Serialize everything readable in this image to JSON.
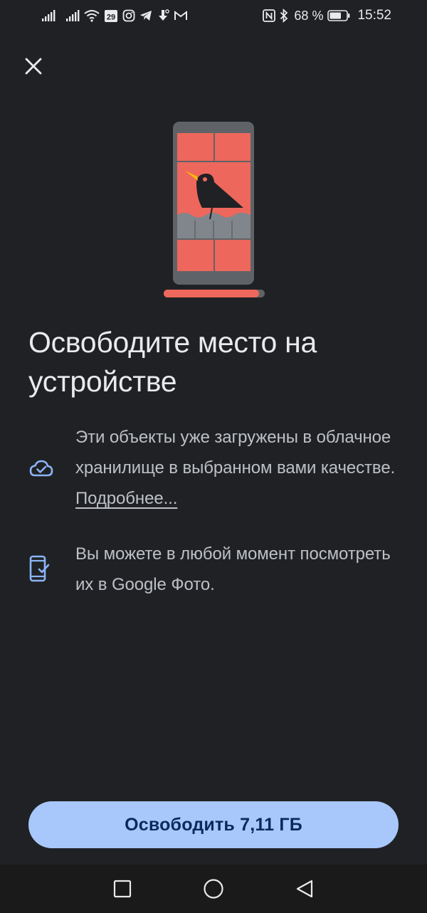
{
  "status_bar": {
    "battery_percent": "68 %",
    "time": "15:52",
    "calendar_badge": "29",
    "icons": [
      "signal-icon",
      "signal-icon",
      "wifi-icon",
      "calendar-icon",
      "instagram-icon",
      "telegram-icon",
      "download-icon",
      "gmail-icon",
      "nfc-icon",
      "bluetooth-icon",
      "battery-icon"
    ]
  },
  "header": {
    "close_icon": "close-icon"
  },
  "illustration": {
    "icon": "phone-bird-illustration",
    "colors": {
      "tile": "#ee675c",
      "frame": "#5f6368",
      "bird": "#202124",
      "beak": "#fbbc04",
      "fence": "#80868b"
    }
  },
  "title": "Освободите место на устройстве",
  "info_items": [
    {
      "icon": "cloud-done-icon",
      "text": "Эти объекты уже загружены в облачное хранилище в выбранном вами качестве.",
      "link": "Подробнее..."
    },
    {
      "icon": "phone-check-icon",
      "text": "Вы можете в любой момент посмотреть их в Google Фото."
    }
  ],
  "primary_button": {
    "label": "Освободить 7,11 ГБ",
    "color": "#a8c7fa"
  },
  "nav_bar": {
    "icons": [
      "recents-icon",
      "home-icon",
      "back-icon"
    ]
  },
  "colors": {
    "background": "#202124",
    "accent": "#a8c7fa",
    "icon_accent": "#8ab4f8"
  }
}
